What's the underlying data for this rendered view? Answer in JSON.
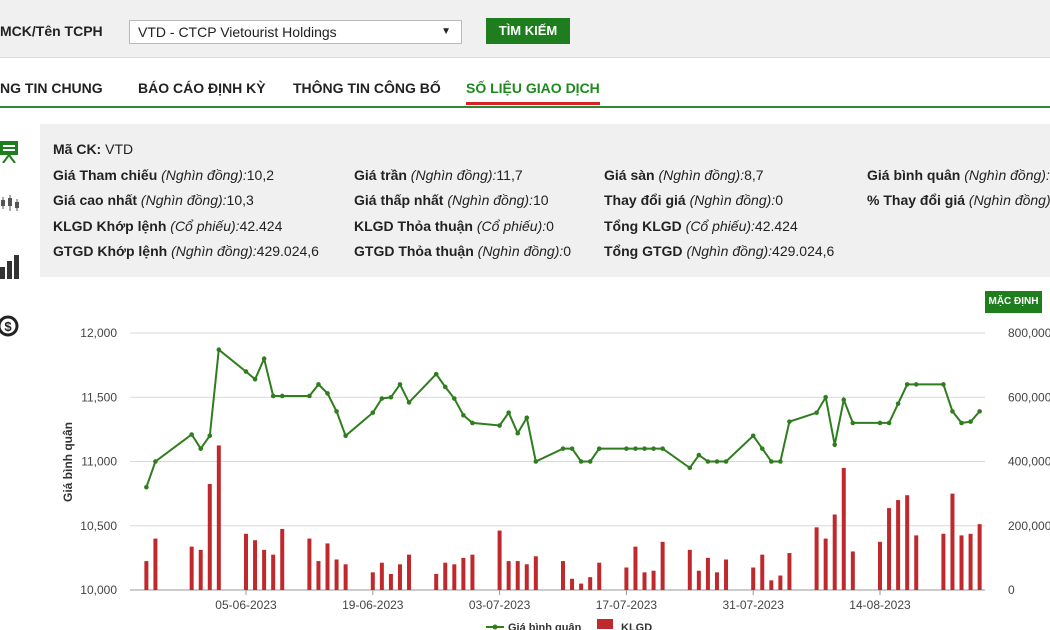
{
  "search": {
    "label": "MCK/Tên TCPH",
    "selected": "VTD - CTCP Vietourist Holdings",
    "button": "TÌM KIẾM"
  },
  "tabs": [
    {
      "label": "NG TIN CHUNG"
    },
    {
      "label": "BÁO CÁO ĐỊNH KỲ"
    },
    {
      "label": "THÔNG TIN CÔNG BỐ"
    },
    {
      "label": "SỐ LIỆU GIAO DỊCH"
    }
  ],
  "side_icons": [
    "presentation-icon",
    "candlestick-icon",
    "bar-chart-icon",
    "dollar-icon"
  ],
  "info": {
    "ma_ck": {
      "key": "Mã CK:",
      "value": "VTD"
    },
    "gia_tham_chieu": {
      "key": "Giá Tham chiếu",
      "unit": "(Nghìn đồng):",
      "value": "10,2"
    },
    "gia_tran": {
      "key": "Giá trần",
      "unit": "(Nghìn đồng):",
      "value": "11,7"
    },
    "gia_san": {
      "key": "Giá sàn",
      "unit": "(Nghìn đồng):",
      "value": "8,7"
    },
    "gia_binh_quan": {
      "key": "Giá bình quân",
      "unit": "(Nghìn đồng):",
      "value": "-"
    },
    "gia_cao_nhat": {
      "key": "Giá cao nhất",
      "unit": "(Nghìn đồng):",
      "value": "10,3"
    },
    "gia_thap_nhat": {
      "key": "Giá thấp nhất",
      "unit": "(Nghìn đồng):",
      "value": "10"
    },
    "thay_doi_gia": {
      "key": "Thay đổi giá",
      "unit": "(Nghìn đồng):",
      "value": "0"
    },
    "pct_thay_doi": {
      "key": "% Thay đổi giá",
      "unit": "(Nghìn đồng):",
      "value": "0"
    },
    "klgd_khop": {
      "key": "KLGD Khớp lệnh",
      "unit": "(Cổ phiếu):",
      "value": "42.424"
    },
    "klgd_thoa": {
      "key": "KLGD Thỏa thuận",
      "unit": "(Cổ phiếu):",
      "value": "0"
    },
    "tong_klgd": {
      "key": "Tổng KLGD",
      "unit": "(Cổ phiếu):",
      "value": "42.424"
    },
    "gtgd_khop": {
      "key": "GTGD Khớp lệnh",
      "unit": "(Nghìn đồng):",
      "value": "429.024,6"
    },
    "gtgd_thoa": {
      "key": "GTGD Thỏa thuận",
      "unit": "(Nghìn đồng):",
      "value": "0"
    },
    "tong_gtgd": {
      "key": "Tổng GTGD",
      "unit": "(Nghìn đồng):",
      "value": "429.024,6"
    }
  },
  "default_button": "MẶC ĐỊNH",
  "colors": {
    "accent": "#1e7e1e",
    "line": "#2f7d1e",
    "bar": "#c0292b",
    "active_tab_underline": "#d6242a"
  },
  "chart_data": {
    "type": "bar",
    "ylabel": "Giá bình quân",
    "y_ticks": [
      "10,000",
      "10,500",
      "11,000",
      "11,500",
      "12,000"
    ],
    "y_tick_values": [
      10000,
      10500,
      11000,
      11500,
      12000
    ],
    "ylim": [
      10000,
      12000
    ],
    "y2_ticks": [
      "0",
      "200,000",
      "400,000",
      "600,000",
      "800,000"
    ],
    "y2_tick_values": [
      0,
      200000,
      400000,
      600000,
      800000
    ],
    "y2lim": [
      0,
      800000
    ],
    "x_tick_labels": [
      "05-06-2023",
      "19-06-2023",
      "03-07-2023",
      "17-07-2023",
      "31-07-2023",
      "14-08-2023"
    ],
    "x_tick_dates": [
      "2023-06-05",
      "2023-06-19",
      "2023-07-03",
      "2023-07-17",
      "2023-07-31",
      "2023-08-14"
    ],
    "grid": true,
    "legend_position": "bottom-center",
    "x": [
      "2023-05-25",
      "2023-05-26",
      "2023-05-30",
      "2023-05-31",
      "2023-06-01",
      "2023-06-02",
      "2023-06-05",
      "2023-06-06",
      "2023-06-07",
      "2023-06-08",
      "2023-06-09",
      "2023-06-12",
      "2023-06-13",
      "2023-06-14",
      "2023-06-15",
      "2023-06-16",
      "2023-06-19",
      "2023-06-20",
      "2023-06-21",
      "2023-06-22",
      "2023-06-23",
      "2023-06-26",
      "2023-06-27",
      "2023-06-28",
      "2023-06-29",
      "2023-06-30",
      "2023-07-03",
      "2023-07-04",
      "2023-07-05",
      "2023-07-06",
      "2023-07-07",
      "2023-07-10",
      "2023-07-11",
      "2023-07-12",
      "2023-07-13",
      "2023-07-14",
      "2023-07-17",
      "2023-07-18",
      "2023-07-19",
      "2023-07-20",
      "2023-07-21",
      "2023-07-24",
      "2023-07-25",
      "2023-07-26",
      "2023-07-27",
      "2023-07-28",
      "2023-07-31",
      "2023-08-01",
      "2023-08-02",
      "2023-08-03",
      "2023-08-04",
      "2023-08-07",
      "2023-08-08",
      "2023-08-09",
      "2023-08-10",
      "2023-08-11",
      "2023-08-14",
      "2023-08-15",
      "2023-08-16",
      "2023-08-17",
      "2023-08-18",
      "2023-08-21",
      "2023-08-22",
      "2023-08-23",
      "2023-08-24",
      "2023-08-25"
    ],
    "series": [
      {
        "name": "Giá bình quân",
        "type": "line",
        "axis": "left",
        "values": [
          10800,
          11000,
          11210,
          11100,
          11200,
          11870,
          11700,
          11640,
          11800,
          11510,
          11510,
          11510,
          11600,
          11530,
          11390,
          11200,
          11380,
          11490,
          11500,
          11600,
          11460,
          11680,
          11580,
          11490,
          11360,
          11300,
          11280,
          11380,
          11220,
          11340,
          11000,
          11100,
          11100,
          11000,
          11000,
          11100,
          11100,
          11100,
          11100,
          11100,
          11100,
          10950,
          11050,
          11000,
          11000,
          11000,
          11200,
          11100,
          11000,
          11000,
          11310,
          11380,
          11500,
          11130,
          11480,
          11300,
          11300,
          11300,
          11450,
          11600,
          11600,
          11600,
          11390,
          11300,
          11310,
          11390
        ]
      },
      {
        "name": "KLGD",
        "type": "bar",
        "axis": "right",
        "values": [
          90000,
          160000,
          135000,
          125000,
          330000,
          450000,
          175000,
          155000,
          125000,
          110000,
          190000,
          160000,
          90000,
          145000,
          95000,
          80000,
          55000,
          85000,
          50000,
          80000,
          110000,
          50000,
          85000,
          80000,
          100000,
          110000,
          185000,
          90000,
          90000,
          80000,
          105000,
          90000,
          35000,
          20000,
          40000,
          85000,
          70000,
          135000,
          55000,
          60000,
          150000,
          125000,
          60000,
          100000,
          55000,
          95000,
          70000,
          110000,
          30000,
          45000,
          115000,
          195000,
          160000,
          235000,
          380000,
          120000,
          150000,
          255000,
          280000,
          295000,
          170000,
          175000,
          300000,
          170000,
          175000,
          205000
        ]
      }
    ]
  },
  "legend": [
    {
      "label": "Giá bình quân"
    },
    {
      "label": "KLGD"
    }
  ]
}
